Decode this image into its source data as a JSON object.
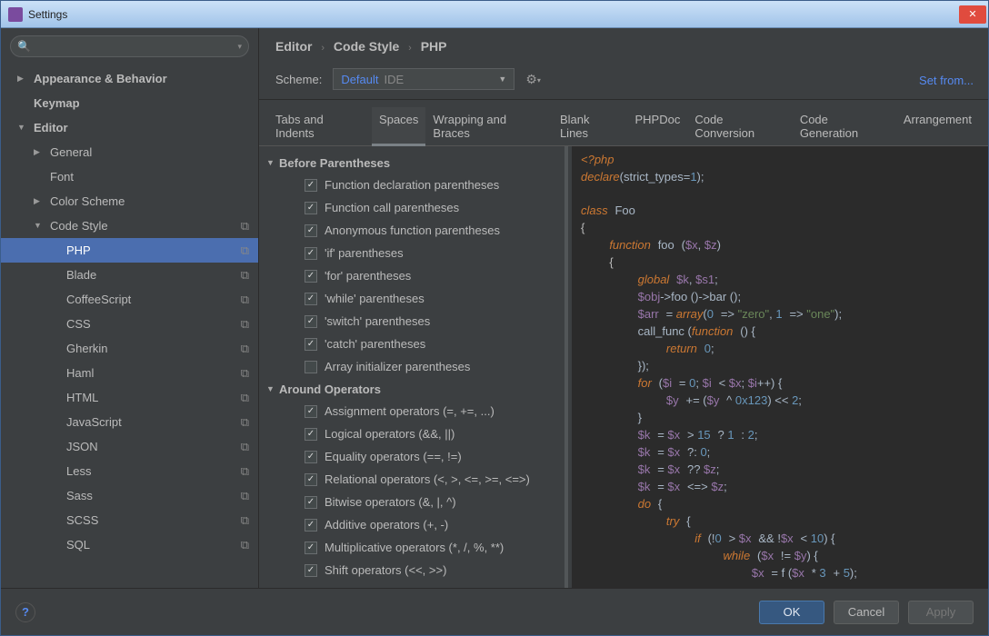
{
  "window": {
    "title": "Settings"
  },
  "sidebar": {
    "search_placeholder": "",
    "items": [
      {
        "label": "Appearance & Behavior",
        "arrow": "closed",
        "depth": 0,
        "bold": true,
        "badge": ""
      },
      {
        "label": "Keymap",
        "arrow": "none",
        "depth": 0,
        "bold": true,
        "badge": ""
      },
      {
        "label": "Editor",
        "arrow": "open",
        "depth": 0,
        "bold": true,
        "badge": ""
      },
      {
        "label": "General",
        "arrow": "closed",
        "depth": 1,
        "bold": false,
        "badge": ""
      },
      {
        "label": "Font",
        "arrow": "none",
        "depth": 1,
        "bold": false,
        "badge": ""
      },
      {
        "label": "Color Scheme",
        "arrow": "closed",
        "depth": 1,
        "bold": false,
        "badge": ""
      },
      {
        "label": "Code Style",
        "arrow": "open",
        "depth": 1,
        "bold": false,
        "badge": "⧉"
      },
      {
        "label": "PHP",
        "arrow": "none",
        "depth": 2,
        "bold": false,
        "badge": "⧉",
        "selected": true
      },
      {
        "label": "Blade",
        "arrow": "none",
        "depth": 2,
        "bold": false,
        "badge": "⧉"
      },
      {
        "label": "CoffeeScript",
        "arrow": "none",
        "depth": 2,
        "bold": false,
        "badge": "⧉"
      },
      {
        "label": "CSS",
        "arrow": "none",
        "depth": 2,
        "bold": false,
        "badge": "⧉"
      },
      {
        "label": "Gherkin",
        "arrow": "none",
        "depth": 2,
        "bold": false,
        "badge": "⧉"
      },
      {
        "label": "Haml",
        "arrow": "none",
        "depth": 2,
        "bold": false,
        "badge": "⧉"
      },
      {
        "label": "HTML",
        "arrow": "none",
        "depth": 2,
        "bold": false,
        "badge": "⧉"
      },
      {
        "label": "JavaScript",
        "arrow": "none",
        "depth": 2,
        "bold": false,
        "badge": "⧉"
      },
      {
        "label": "JSON",
        "arrow": "none",
        "depth": 2,
        "bold": false,
        "badge": "⧉"
      },
      {
        "label": "Less",
        "arrow": "none",
        "depth": 2,
        "bold": false,
        "badge": "⧉"
      },
      {
        "label": "Sass",
        "arrow": "none",
        "depth": 2,
        "bold": false,
        "badge": "⧉"
      },
      {
        "label": "SCSS",
        "arrow": "none",
        "depth": 2,
        "bold": false,
        "badge": "⧉"
      },
      {
        "label": "SQL",
        "arrow": "none",
        "depth": 2,
        "bold": false,
        "badge": "⧉"
      }
    ]
  },
  "breadcrumb": {
    "a": "Editor",
    "b": "Code Style",
    "c": "PHP"
  },
  "scheme": {
    "label": "Scheme:",
    "value": "Default",
    "kind": "IDE"
  },
  "setfrom": "Set from...",
  "tabs": [
    "Tabs and Indents",
    "Spaces",
    "Wrapping and Braces",
    "Blank Lines",
    "PHPDoc",
    "Code Conversion",
    "Code Generation",
    "Arrangement"
  ],
  "active_tab": 1,
  "sections": [
    {
      "title": "Before Parentheses",
      "items": [
        {
          "label": "Function declaration parentheses",
          "checked": true
        },
        {
          "label": "Function call parentheses",
          "checked": true
        },
        {
          "label": "Anonymous function parentheses",
          "checked": true
        },
        {
          "label": "'if' parentheses",
          "checked": true
        },
        {
          "label": "'for' parentheses",
          "checked": true
        },
        {
          "label": "'while' parentheses",
          "checked": true
        },
        {
          "label": "'switch' parentheses",
          "checked": true
        },
        {
          "label": "'catch' parentheses",
          "checked": true
        },
        {
          "label": "Array initializer parentheses",
          "checked": false
        }
      ]
    },
    {
      "title": "Around Operators",
      "items": [
        {
          "label": "Assignment operators (=, +=, ...)",
          "checked": true
        },
        {
          "label": "Logical operators (&&, ||)",
          "checked": true
        },
        {
          "label": "Equality operators (==, !=)",
          "checked": true
        },
        {
          "label": "Relational operators (<, >, <=, >=, <=>)",
          "checked": true
        },
        {
          "label": "Bitwise operators (&, |, ^)",
          "checked": true
        },
        {
          "label": "Additive operators (+, -)",
          "checked": true
        },
        {
          "label": "Multiplicative operators (*, /, %, **)",
          "checked": true
        },
        {
          "label": "Shift operators (<<, >>)",
          "checked": true
        }
      ]
    }
  ],
  "buttons": {
    "ok": "OK",
    "cancel": "Cancel",
    "apply": "Apply"
  }
}
